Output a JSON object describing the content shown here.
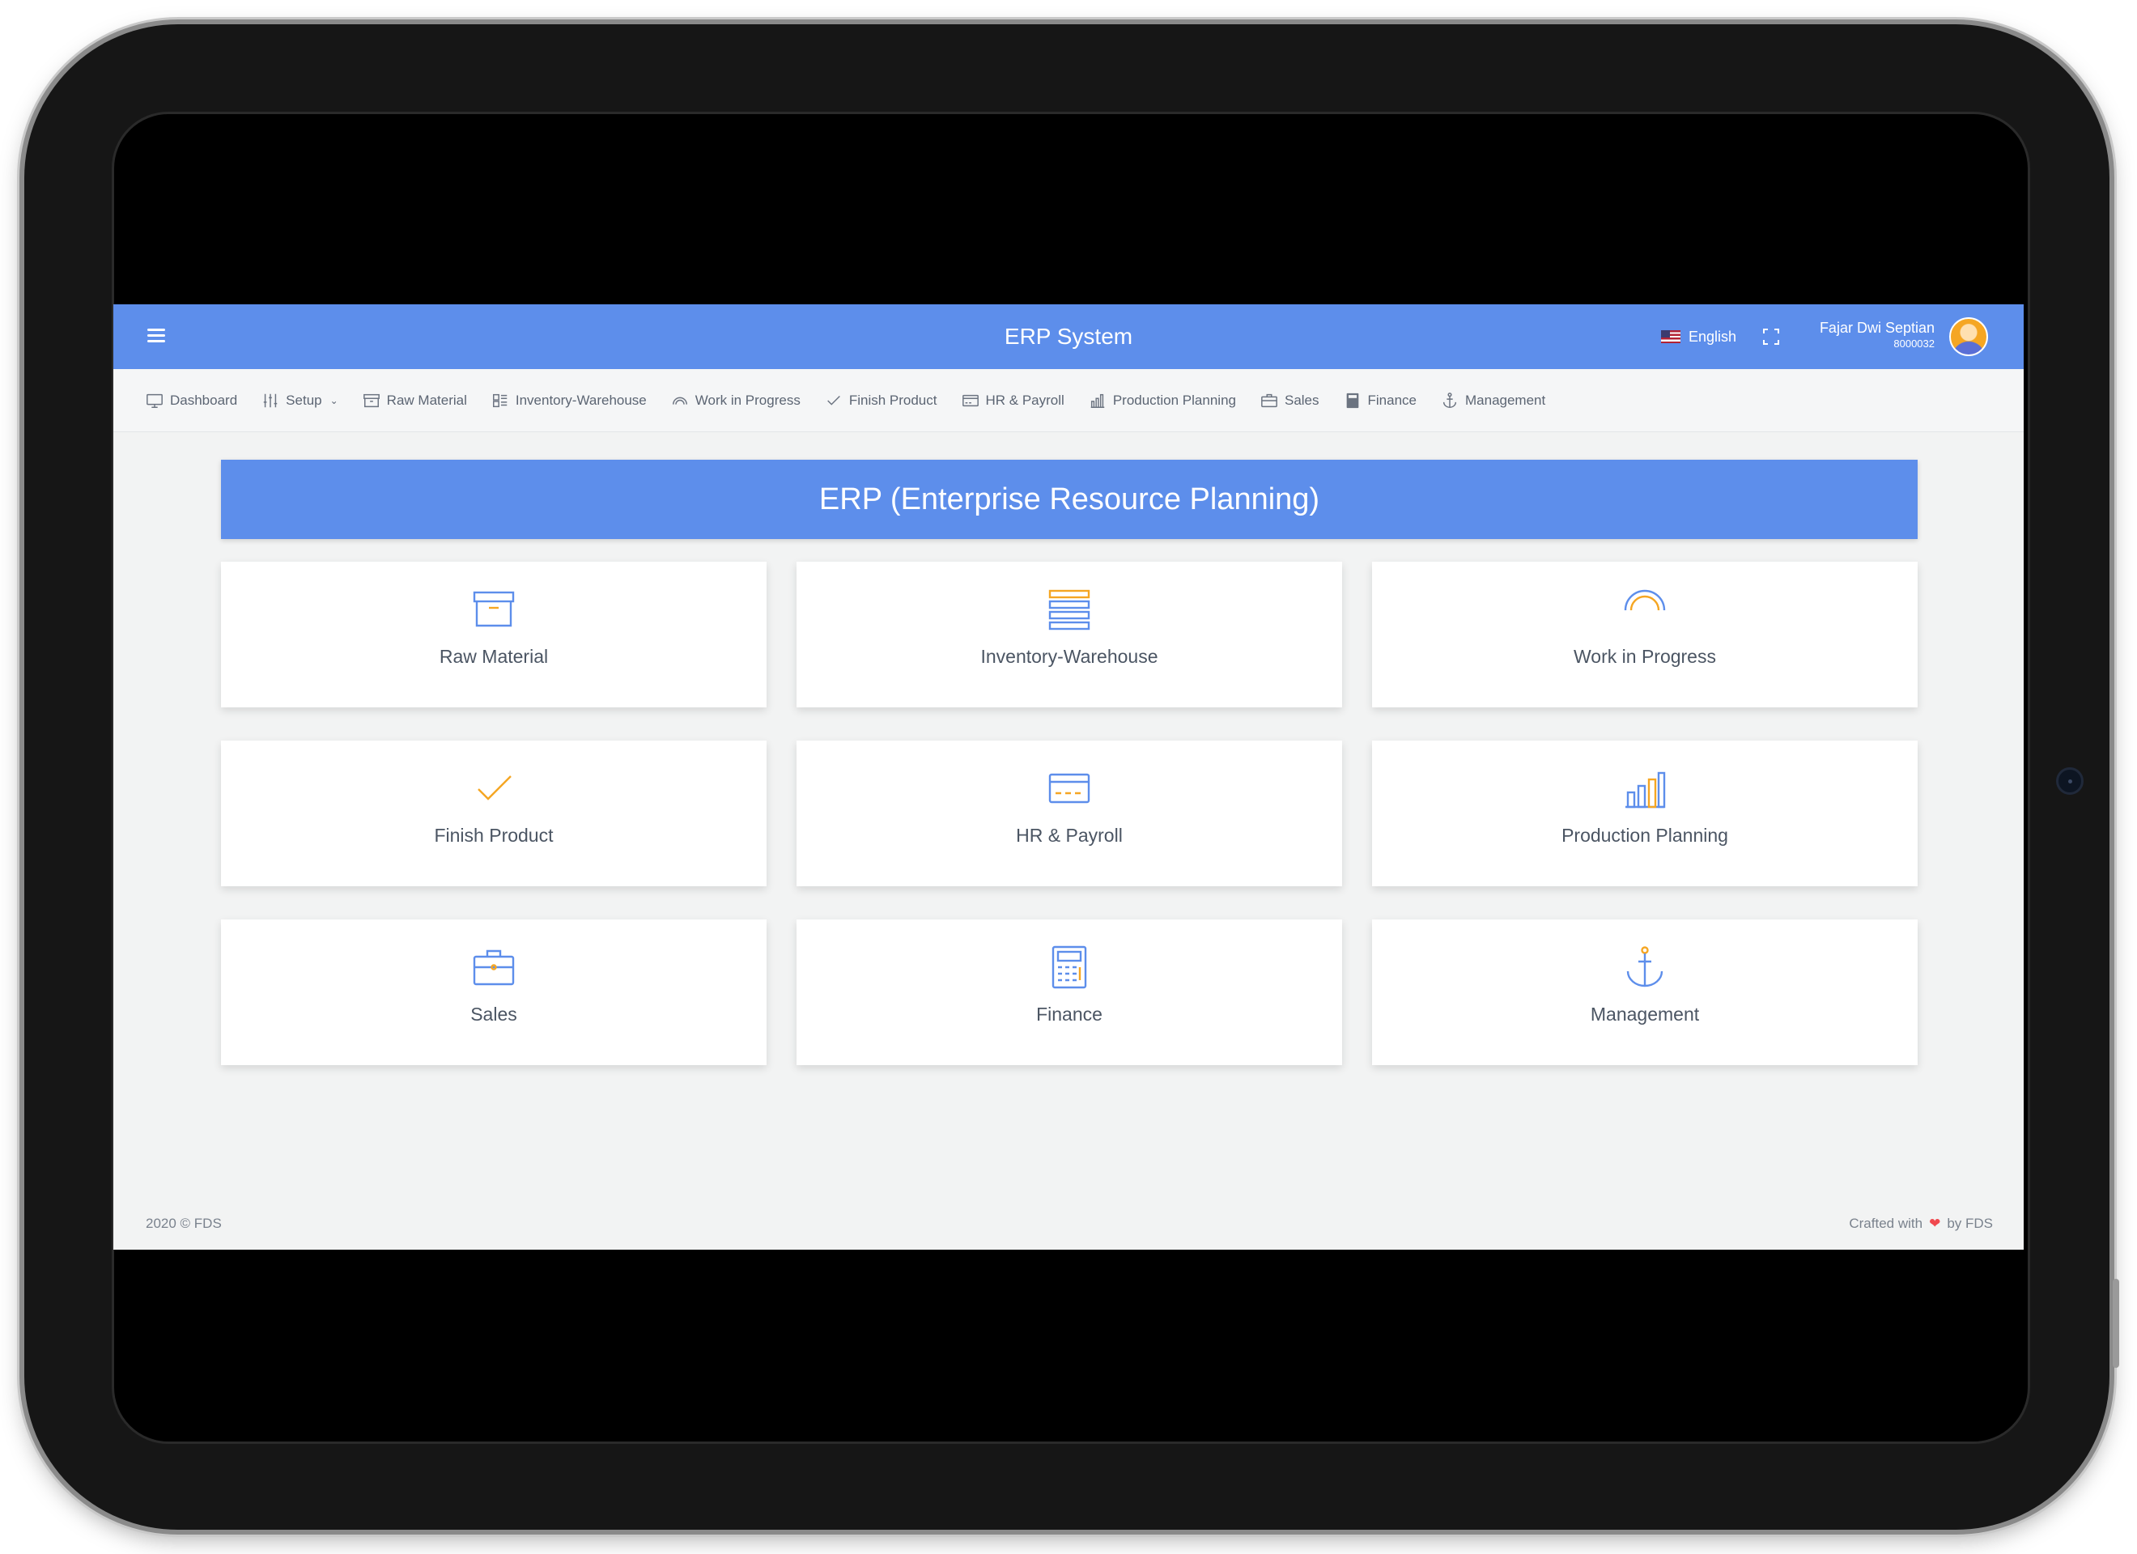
{
  "header": {
    "title": "ERP System",
    "language": "English",
    "user_name": "Fajar Dwi Septian",
    "user_id": "8000032",
    "icons": [
      "menu-icon",
      "us-flag-icon",
      "fullscreen-icon",
      "avatar"
    ]
  },
  "menu": {
    "items": [
      {
        "label": "Dashboard",
        "icon": "monitor-icon"
      },
      {
        "label": "Setup",
        "icon": "sliders-icon",
        "dropdown": true
      },
      {
        "label": "Raw Material",
        "icon": "archive-box-icon"
      },
      {
        "label": "Inventory-Warehouse",
        "icon": "layers-icon"
      },
      {
        "label": "Work in Progress",
        "icon": "rainbow-icon"
      },
      {
        "label": "Finish Product",
        "icon": "check-icon"
      },
      {
        "label": "HR & Payroll",
        "icon": "credit-card-icon"
      },
      {
        "label": "Production Planning",
        "icon": "bar-chart-icon"
      },
      {
        "label": "Sales",
        "icon": "briefcase-icon"
      },
      {
        "label": "Finance",
        "icon": "calculator-icon"
      },
      {
        "label": "Management",
        "icon": "anchor-icon"
      }
    ]
  },
  "banner": {
    "title": "ERP (Enterprise Resource Planning)"
  },
  "cards": [
    {
      "label": "Raw Material",
      "icon": "archive-box-icon"
    },
    {
      "label": "Inventory-Warehouse",
      "icon": "layers-icon"
    },
    {
      "label": "Work in Progress",
      "icon": "rainbow-icon"
    },
    {
      "label": "Finish Product",
      "icon": "check-icon"
    },
    {
      "label": "HR & Payroll",
      "icon": "credit-card-icon"
    },
    {
      "label": "Production Planning",
      "icon": "bar-chart-icon"
    },
    {
      "label": "Sales",
      "icon": "briefcase-icon"
    },
    {
      "label": "Finance",
      "icon": "calculator-icon"
    },
    {
      "label": "Management",
      "icon": "anchor-icon"
    }
  ],
  "footer": {
    "copyright": "2020 © FDS",
    "crafted_prefix": "Crafted with",
    "crafted_suffix": "by FDS"
  },
  "colors": {
    "primary": "#5d8eeb",
    "accent_orange": "#f5a623",
    "heart": "#f0484e",
    "background": "#f2f3f3"
  }
}
